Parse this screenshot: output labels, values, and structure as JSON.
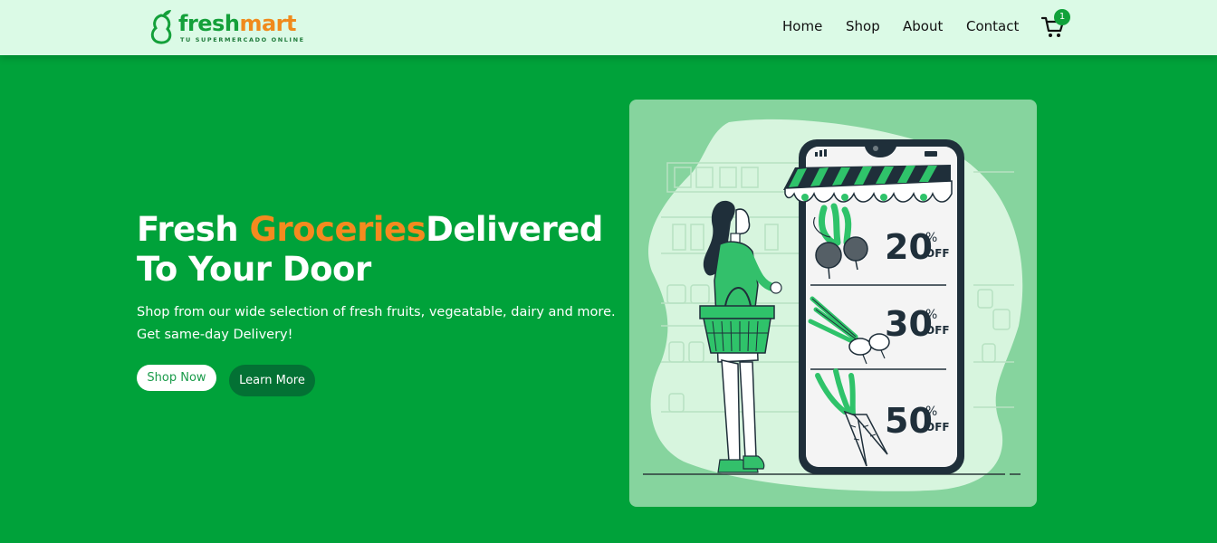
{
  "brand": {
    "name_part1": "fresh",
    "name_part2": "mart",
    "tagline": "TU SUPERMERCADO ONLINE",
    "logo_icon": "pear-leaf-icon"
  },
  "nav": {
    "items": [
      {
        "label": "Home"
      },
      {
        "label": "Shop"
      },
      {
        "label": "About"
      },
      {
        "label": "Contact"
      }
    ],
    "cart_icon": "shopping-cart-icon",
    "cart_count": "1"
  },
  "hero": {
    "title_part1": "Fresh ",
    "title_accent": "Groceries",
    "title_part2": "Delivered",
    "title_line2": "To Your Door",
    "subtitle_line1": "Shop from our wide selection of fresh fruits, vegeatable, dairy and more.",
    "subtitle_line2": "Get same-day Delivery!",
    "primary_button": "Shop Now",
    "secondary_button": "Learn More"
  },
  "illustration": {
    "description_icon": "grocery-shopping-phone-illustration",
    "offers": [
      {
        "value": "20",
        "suffix_pct": "%",
        "suffix_off": "OFF",
        "icon": "beetroot-icon"
      },
      {
        "value": "30",
        "suffix_pct": "%",
        "suffix_off": "OFF",
        "icon": "leek-icon"
      },
      {
        "value": "50",
        "suffix_pct": "%",
        "suffix_off": "OFF",
        "icon": "carrot-icon"
      }
    ]
  },
  "colors": {
    "hero_bg": "#00a23a",
    "navbar_bg": "#dbfae6",
    "accent_orange": "#f58a1f",
    "button_dark": "#037134",
    "illustration_bg": "#86d49e"
  }
}
